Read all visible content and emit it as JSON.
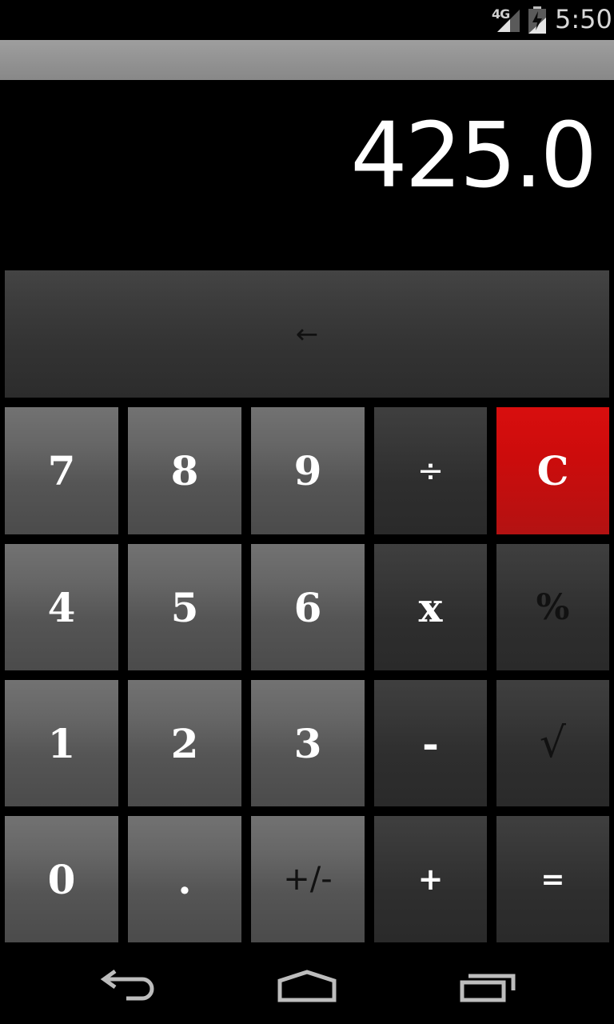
{
  "status_bar": {
    "network": "4G",
    "time": "5:50",
    "icons": [
      "signal-icon",
      "battery-charging-icon"
    ]
  },
  "display": {
    "value": "425.0"
  },
  "keys": {
    "backspace": "←",
    "k7": "7",
    "k8": "8",
    "k9": "9",
    "divide": "÷",
    "clear": "C",
    "k4": "4",
    "k5": "5",
    "k6": "6",
    "multiply": "x",
    "percent": "%",
    "k1": "1",
    "k2": "2",
    "k3": "3",
    "minus": "-",
    "sqrt": "√",
    "k0": "0",
    "dot": ".",
    "plusminus": "+/-",
    "plus": "+",
    "equals": "="
  },
  "colors": {
    "clear_key": "#cc0c0c",
    "number_key": "#5e5e5e",
    "operator_key": "#333333",
    "display_text": "#ffffff"
  },
  "nav_bar": {
    "icons": [
      "back-icon",
      "home-icon",
      "recents-icon"
    ]
  }
}
